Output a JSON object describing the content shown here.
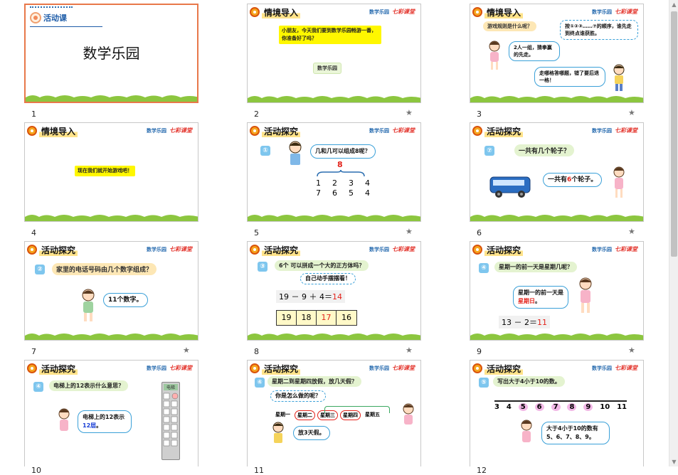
{
  "scrollbar": {
    "up": "▲",
    "down": "▼"
  },
  "star": "★",
  "slides": [
    {
      "num": "1",
      "tag": "活动课",
      "title": "数学乐园"
    },
    {
      "num": "2",
      "header": "情境导入",
      "brand": "数学乐园",
      "brand2": "七彩课堂",
      "text": "小朋友，今天我们要到数学乐园畅游一番，你准备好了吗？",
      "label": "数学乐园"
    },
    {
      "num": "3",
      "header": "情境导入",
      "brand": "数学乐园",
      "brand2": "七彩课堂",
      "q": "游戏规则是什么呢？",
      "rule": "按①②③……⑦的顺序，谁先走到终点谁获胜。",
      "b1": "2人一组，猜拳赢的先走。",
      "b2": "走哪格答哪题，错了要后退一格！"
    },
    {
      "num": "4",
      "header": "情境导入",
      "brand": "数学乐园",
      "brand2": "七彩课堂",
      "text": "现在我们就开始游戏吧！"
    },
    {
      "num": "5",
      "header": "活动探究",
      "brand": "数学乐园",
      "brand2": "七彩课堂",
      "badge": "①",
      "q": "几和几可以组成8呢？",
      "top": "8",
      "row1": [
        "1",
        "2",
        "3",
        "4"
      ],
      "row2": [
        "7",
        "6",
        "5",
        "4"
      ]
    },
    {
      "num": "6",
      "header": "活动探究",
      "brand": "数学乐园",
      "brand2": "七彩课堂",
      "badge": "⑦",
      "q": "一共有几个轮子？",
      "a_pre": "一共有",
      "a_num": "6",
      "a_post": "个轮子。"
    },
    {
      "num": "7",
      "header": "活动探究",
      "brand": "数学乐园",
      "brand2": "七彩课堂",
      "badge": "②",
      "q": "家里的电话号码由几个数字组成？",
      "a": "11个数字。"
    },
    {
      "num": "8",
      "header": "活动探究",
      "brand": "数学乐园",
      "brand2": "七彩课堂",
      "badge": "③",
      "q": "6个 可以拼成一个大的正方体吗？",
      "hint": "自己动手摆摆看！",
      "eq": "19 － 9 ＋ 4＝",
      "eq_ans": "14",
      "cells": [
        "19",
        "18",
        "17",
        "16"
      ]
    },
    {
      "num": "9",
      "header": "活动探究",
      "brand": "数学乐园",
      "brand2": "七彩课堂",
      "badge": "④",
      "q": "星期一的前一天是星期几呢？",
      "a_pre": "星期一的前一天是",
      "a_red": "星期日",
      "a_post": "。",
      "eq": "13 － 2＝",
      "eq_ans": "11"
    },
    {
      "num": "10",
      "header": "活动探究",
      "brand": "数学乐园",
      "brand2": "七彩课堂",
      "badge": "④",
      "q": "电梯上的12表示什么意思？",
      "a_pre": "电梯上的12表示",
      "a_blue": "12层",
      "a_post": "。",
      "panel": "电梯"
    },
    {
      "num": "11",
      "header": "活动探究",
      "brand": "数学乐园",
      "brand2": "七彩课堂",
      "badge": "④",
      "q": "星期二到星期四放假，放几天假？",
      "q2": "你是怎么做的呢？",
      "days": [
        "星期一",
        "星期二",
        "星期三",
        "星期四",
        "星期五"
      ],
      "a": "放3天假。"
    },
    {
      "num": "12",
      "header": "活动探究",
      "brand": "数学乐园",
      "brand2": "七彩课堂",
      "badge": "⑤",
      "q": "写出大于4小于10的数。",
      "line": [
        "3",
        "4",
        "5",
        "6",
        "7",
        "8",
        "9",
        "10",
        "11"
      ],
      "a": "大于4小于10的数有5、6、7、8、9。"
    }
  ]
}
